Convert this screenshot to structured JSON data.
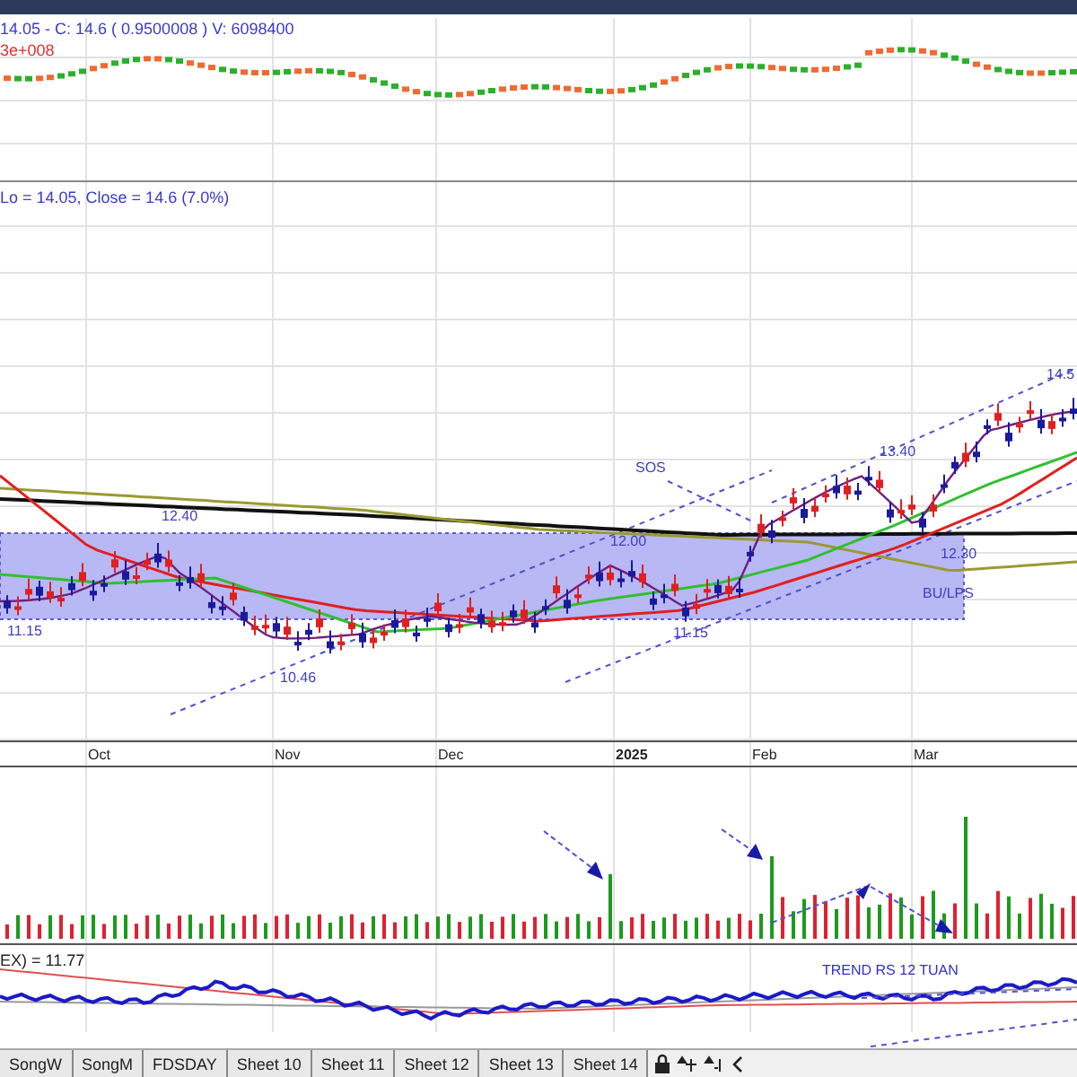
{
  "top_pane": {
    "quote": "14.05 - C: 14.6 ( 0.9500008 ) V: 6098400",
    "scale": "3e+008"
  },
  "price_pane": {
    "quote": "Lo = 14.05, Close = 14.6 (7.0%)",
    "annotations": [
      {
        "text": "12.40"
      },
      {
        "text": "11.15"
      },
      {
        "text": "10.46"
      },
      {
        "text": "12.00"
      },
      {
        "text": "11.15"
      },
      {
        "text": "SOS"
      },
      {
        "text": "13.40"
      },
      {
        "text": "12.30"
      },
      {
        "text": "BU/LPS"
      },
      {
        "text": "14.5"
      }
    ],
    "date_axis": [
      {
        "text": "Oct",
        "bold": false
      },
      {
        "text": "Nov",
        "bold": false
      },
      {
        "text": "Dec",
        "bold": false
      },
      {
        "text": "2025",
        "bold": true
      },
      {
        "text": "Feb",
        "bold": false
      },
      {
        "text": "Mar",
        "bold": false
      }
    ]
  },
  "rs_pane": {
    "quote": "EX) = 11.77",
    "annotation": "TREND RS 12 TUAN"
  },
  "sheet_tabs": [
    {
      "label": "SongW"
    },
    {
      "label": "SongM"
    },
    {
      "label": "FDSDAY"
    },
    {
      "label": "Sheet 10"
    },
    {
      "label": "Sheet 11"
    },
    {
      "label": "Sheet 12"
    },
    {
      "label": "Sheet 13"
    },
    {
      "label": "Sheet 14"
    }
  ]
}
